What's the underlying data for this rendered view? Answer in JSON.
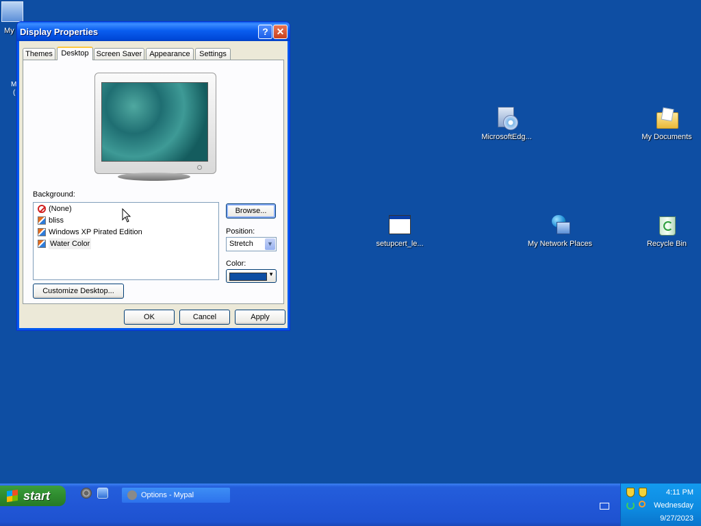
{
  "desktop": {
    "icons": [
      {
        "label": "My",
        "icon": "my-computer-icon"
      },
      {
        "label": "MicrosoftEdg...",
        "icon": "installer-disc-icon"
      },
      {
        "label": "My Documents",
        "icon": "folder-icon"
      },
      {
        "label": "setupcert_le...",
        "icon": "window-app-icon"
      },
      {
        "label": "My Network Places",
        "icon": "network-places-icon"
      },
      {
        "label": "Recycle Bin",
        "icon": "recycle-bin-icon"
      }
    ],
    "edge_fragments": [
      "M",
      "("
    ]
  },
  "dialog": {
    "title": "Display Properties",
    "help": "?",
    "close": "✕",
    "tabs": [
      "Themes",
      "Desktop",
      "Screen Saver",
      "Appearance",
      "Settings"
    ],
    "active_tab": "Desktop",
    "background_label": "Background:",
    "backgrounds": [
      "(None)",
      "bliss",
      "Windows XP Pirated Edition",
      "Water Color"
    ],
    "selected_background": "Water Color",
    "browse": "Browse...",
    "position_label": "Position:",
    "position_value": "Stretch",
    "color_label": "Color:",
    "color_value": "#0e4ea3",
    "customize": "Customize Desktop...",
    "ok": "OK",
    "cancel": "Cancel",
    "apply": "Apply"
  },
  "taskbar": {
    "start": "start",
    "task_item": "Options - Mypal",
    "clock": {
      "time": "4:11 PM",
      "day": "Wednesday",
      "date": "9/27/2023"
    }
  }
}
